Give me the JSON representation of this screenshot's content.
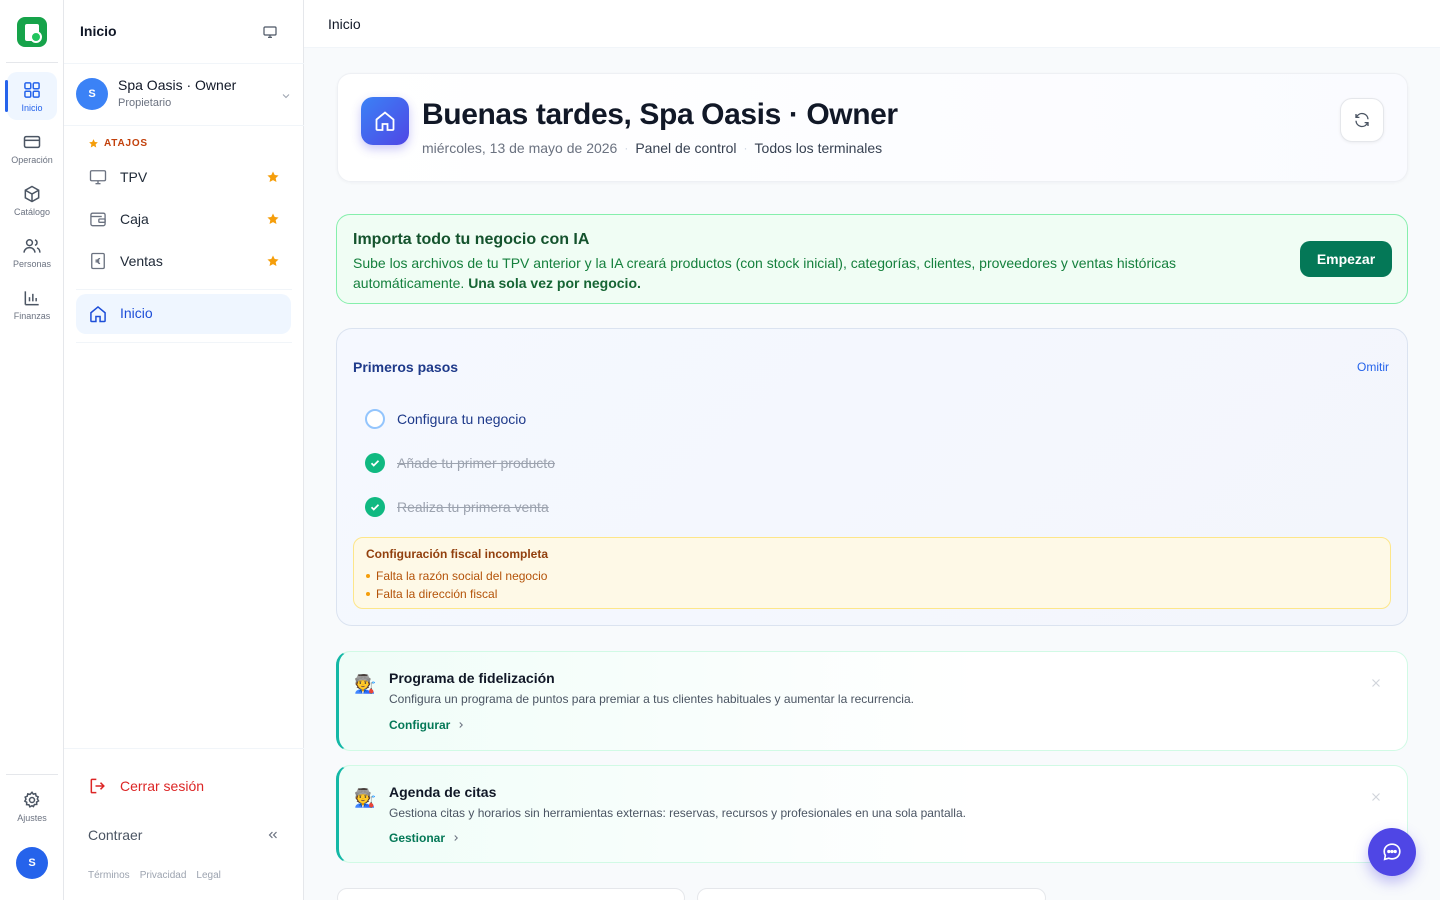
{
  "rail": {
    "items": [
      {
        "label": "Inicio",
        "icon": "grid-icon",
        "active": true
      },
      {
        "label": "Operación",
        "icon": "card-icon"
      },
      {
        "label": "Catálogo",
        "icon": "box-icon"
      },
      {
        "label": "Personas",
        "icon": "users-icon"
      },
      {
        "label": "Finanzas",
        "icon": "bar-chart-icon"
      }
    ],
    "settings_label": "Ajustes",
    "avatar_initial": "S"
  },
  "sidebar": {
    "title": "Inicio",
    "account": {
      "initial": "S",
      "name": "Spa Oasis · Owner",
      "role": "Propietario"
    },
    "shortcuts_label": "ATAJOS",
    "shortcuts": [
      {
        "label": "TPV",
        "icon": "monitor-icon"
      },
      {
        "label": "Caja",
        "icon": "wallet-icon"
      },
      {
        "label": "Ventas",
        "icon": "euro-receipt-icon"
      }
    ],
    "nav_home": "Inicio",
    "logout": "Cerrar sesión",
    "collapse": "Contraer",
    "legal": [
      "Términos",
      "Privacidad",
      "Legal"
    ]
  },
  "topbar": {
    "title": "Inicio"
  },
  "greeting": {
    "title": "Buenas tardes, Spa Oasis · Owner",
    "date": "miércoles, 13 de mayo de 2026",
    "panel": "Panel de control",
    "terminals": "Todos los terminales"
  },
  "ai_import": {
    "title": "Importa todo tu negocio con IA",
    "description": "Sube los archivos de tu TPV anterior y la IA creará productos (con stock inicial), categorías, clientes, proveedores y ventas históricas automáticamente.",
    "emphasis": "Una sola vez por negocio.",
    "button": "Empezar"
  },
  "first_steps": {
    "title": "Primeros pasos",
    "skip": "Omitir",
    "steps": [
      {
        "label": "Configura tu negocio",
        "done": false
      },
      {
        "label": "Añade tu primer producto",
        "done": true
      },
      {
        "label": "Realiza tu primera venta",
        "done": true
      }
    ],
    "warning": {
      "title": "Configuración fiscal incompleta",
      "items": [
        "Falta la razón social del negocio",
        "Falta la dirección fiscal"
      ]
    }
  },
  "features": [
    {
      "emoji": "🧑‍🏭",
      "title": "Programa de fidelización",
      "description": "Configura un programa de puntos para premiar a tus clientes habituales y aumentar la recurrencia.",
      "link": "Configurar"
    },
    {
      "emoji": "🧑‍🏭",
      "title": "Agenda de citas",
      "description": "Gestiona citas y horarios sin herramientas externas: reservas, recursos y profesionales en una sola pantalla.",
      "link": "Gestionar"
    }
  ],
  "colors": {
    "primary": "#2563eb",
    "success": "#047857",
    "danger": "#dc2626",
    "warning": "#b45309",
    "accent": "#4f46e5"
  }
}
